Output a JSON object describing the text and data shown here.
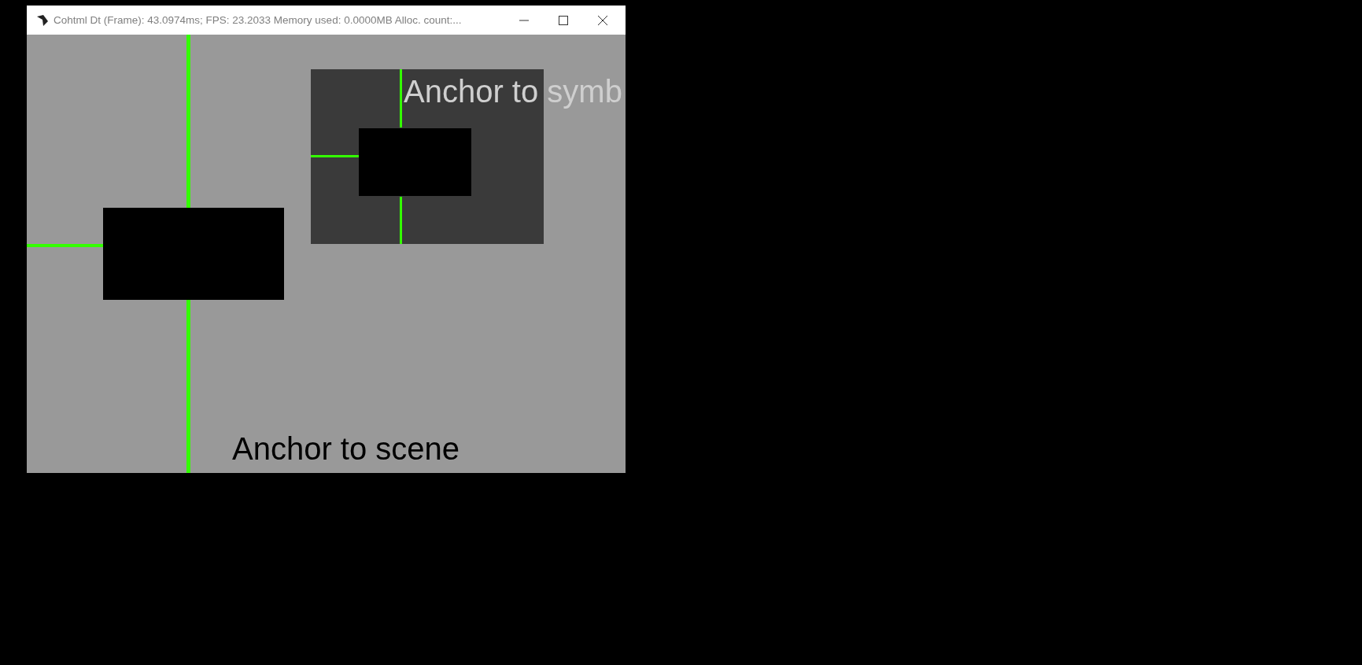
{
  "window": {
    "title": "Cohtml Dt (Frame): 43.0974ms; FPS: 23.2033 Memory used: 0.0000MB Alloc. count:..."
  },
  "scene": {
    "symbol_label": "Anchor to symb",
    "scene_label": "Anchor to scene"
  }
}
